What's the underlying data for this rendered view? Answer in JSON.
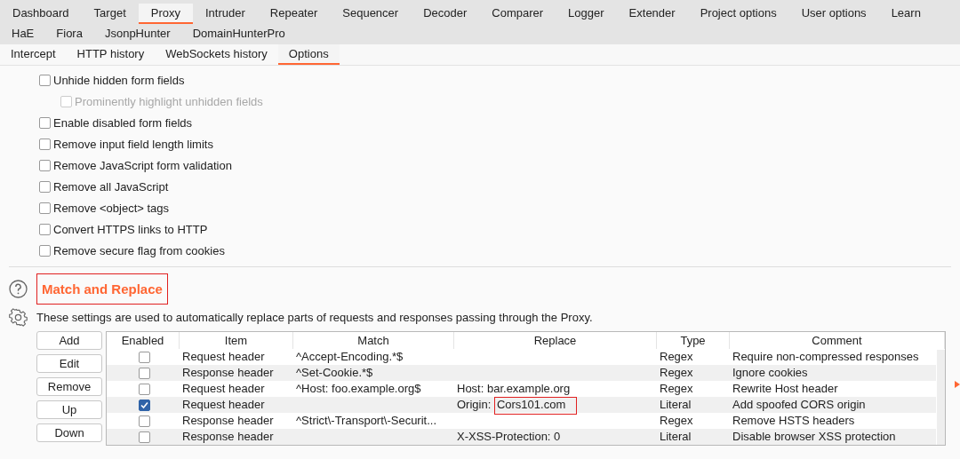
{
  "main_tabs": [
    {
      "label": "Dashboard",
      "selected": false
    },
    {
      "label": "Target",
      "selected": false
    },
    {
      "label": "Proxy",
      "selected": true
    },
    {
      "label": "Intruder",
      "selected": false
    },
    {
      "label": "Repeater",
      "selected": false
    },
    {
      "label": "Sequencer",
      "selected": false
    },
    {
      "label": "Decoder",
      "selected": false
    },
    {
      "label": "Comparer",
      "selected": false
    },
    {
      "label": "Logger",
      "selected": false
    },
    {
      "label": "Extender",
      "selected": false
    },
    {
      "label": "Project options",
      "selected": false
    },
    {
      "label": "User options",
      "selected": false
    },
    {
      "label": "Learn",
      "selected": false
    }
  ],
  "extension_tabs": [
    {
      "label": "HaE",
      "selected": false
    },
    {
      "label": "Fiora",
      "selected": false
    },
    {
      "label": "JsonpHunter",
      "selected": false
    },
    {
      "label": "DomainHunterPro",
      "selected": false
    }
  ],
  "sub_tabs": [
    {
      "label": "Intercept",
      "selected": false
    },
    {
      "label": "HTTP history",
      "selected": false
    },
    {
      "label": "WebSockets history",
      "selected": false
    },
    {
      "label": "Options",
      "selected": true
    }
  ],
  "options": [
    {
      "label": "Unhide hidden form fields",
      "checked": false,
      "disabled": false,
      "children": [
        {
          "label": "Prominently highlight unhidden fields",
          "checked": false,
          "disabled": true
        }
      ]
    },
    {
      "label": "Enable disabled form fields",
      "checked": false,
      "disabled": false
    },
    {
      "label": "Remove input field length limits",
      "checked": false,
      "disabled": false
    },
    {
      "label": "Remove JavaScript form validation",
      "checked": false,
      "disabled": false
    },
    {
      "label": "Remove all JavaScript",
      "checked": false,
      "disabled": false
    },
    {
      "label": "Remove <object> tags",
      "checked": false,
      "disabled": false
    },
    {
      "label": "Convert HTTPS links to HTTP",
      "checked": false,
      "disabled": false
    },
    {
      "label": "Remove secure flag from cookies",
      "checked": false,
      "disabled": false
    }
  ],
  "match_replace": {
    "title": "Match and Replace",
    "description": "These settings are used to automatically replace parts of requests and responses passing through the Proxy.",
    "buttons": [
      "Add",
      "Edit",
      "Remove",
      "Up",
      "Down"
    ],
    "columns": [
      "Enabled",
      "Item",
      "Match",
      "Replace",
      "Type",
      "Comment"
    ],
    "rows": [
      {
        "enabled": false,
        "item": "Request header",
        "match": "^Accept-Encoding.*$",
        "replace": "",
        "type": "Regex",
        "comment": "Require non-compressed responses"
      },
      {
        "enabled": false,
        "item": "Response header",
        "match": "^Set-Cookie.*$",
        "replace": "",
        "type": "Regex",
        "comment": "Ignore cookies"
      },
      {
        "enabled": false,
        "item": "Request header",
        "match": "^Host: foo.example.org$",
        "replace": "Host: bar.example.org",
        "type": "Regex",
        "comment": "Rewrite Host header"
      },
      {
        "enabled": true,
        "item": "Request header",
        "match": "",
        "replace": "Origin:",
        "replace_highlight": "Cors101.com",
        "type": "Literal",
        "comment": "Add spoofed CORS origin"
      },
      {
        "enabled": false,
        "item": "Response header",
        "match": "^Strict\\-Transport\\-Securit...",
        "replace": "",
        "type": "Regex",
        "comment": "Remove HSTS headers"
      },
      {
        "enabled": false,
        "item": "Response header",
        "match": "",
        "replace": "X-XSS-Protection: 0",
        "type": "Literal",
        "comment": "Disable browser XSS protection"
      }
    ]
  }
}
